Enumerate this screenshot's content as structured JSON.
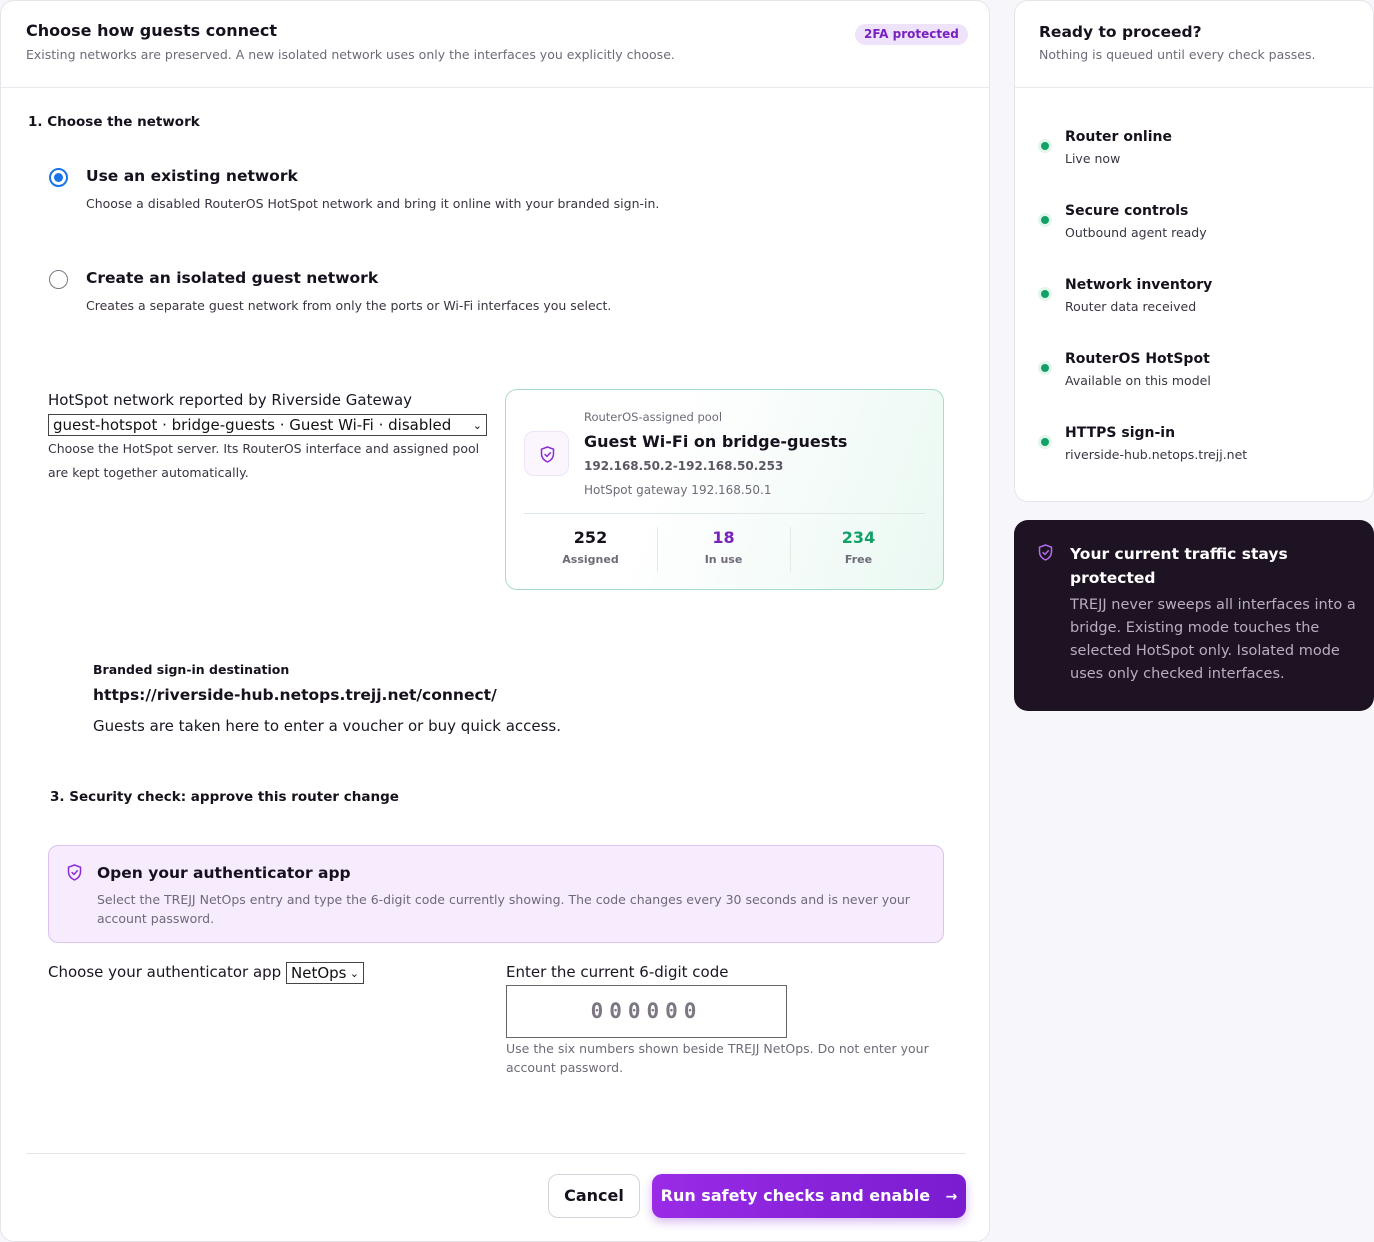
{
  "header": {
    "title": "Choose how guests connect",
    "subtitle": "Existing networks are preserved. A new isolated network uses only the interfaces you explicitly choose.",
    "badge": "2FA protected"
  },
  "step1": {
    "title": "1. Choose the network",
    "options": [
      {
        "title": "Use an existing network",
        "desc": "Choose a disabled RouterOS HotSpot network and bring it online with your branded sign-in.",
        "selected": true
      },
      {
        "title": "Create an isolated guest network",
        "desc": "Creates a separate guest network from only the ports or Wi-Fi interfaces you select.",
        "selected": false
      }
    ]
  },
  "hotspot": {
    "label": "HotSpot network reported by Riverside Gateway",
    "selected": "guest-hotspot · bridge-guests · Guest Wi-Fi · disabled",
    "help_line1": "Choose the HotSpot server. Its RouterOS interface and assigned pool",
    "help_line2": "are kept together automatically."
  },
  "pool": {
    "kicker": "RouterOS-assigned pool",
    "name": "Guest Wi-Fi on bridge-guests",
    "range": "192.168.50.2-192.168.50.253",
    "gateway": "HotSpot gateway 192.168.50.1",
    "stats": [
      {
        "value": "252",
        "label": "Assigned",
        "color": "#16111d"
      },
      {
        "value": "18",
        "label": "In use",
        "color": "#7722bf"
      },
      {
        "value": "234",
        "label": "Free",
        "color": "#13a068"
      }
    ]
  },
  "destination": {
    "label": "Branded sign-in destination",
    "url": "https://riverside-hub.netops.trejj.net/connect/",
    "desc": "Guests are taken here to enter a voucher or buy quick access."
  },
  "step3": {
    "title": "3. Security check: approve this router change",
    "auth_title": "Open your authenticator app",
    "auth_desc": "Select the TREJJ NetOps entry and type the 6-digit code currently showing. The code changes every 30 seconds and is never your account password.",
    "app_label": "Choose your authenticator app",
    "app_selected": "NetOps",
    "code_label": "Enter the current 6-digit code",
    "code_placeholder": "000000",
    "code_help": "Use the six numbers shown beside TREJJ NetOps. Do not enter your account password."
  },
  "footer": {
    "cancel": "Cancel",
    "run": "Run safety checks and enable",
    "run_arrow": "→"
  },
  "side": {
    "title": "Ready to proceed?",
    "subtitle": "Nothing is queued until every check passes.",
    "checks": [
      {
        "title": "Router online",
        "sub": "Live now"
      },
      {
        "title": "Secure controls",
        "sub": "Outbound agent ready"
      },
      {
        "title": "Network inventory",
        "sub": "Router data received"
      },
      {
        "title": "RouterOS HotSpot",
        "sub": "Available on this model"
      },
      {
        "title": "HTTPS sign-in",
        "sub": "riverside-hub.netops.trejj.net"
      }
    ]
  },
  "notice": {
    "title": "Your current traffic stays protected",
    "body": "TREJJ never sweeps all interfaces into a bridge. Existing mode touches the selected HotSpot only. Isolated mode uses only checked interfaces."
  },
  "icons": {
    "shield": "shield-icon",
    "chevron": "chevron-down-icon",
    "arrow": "arrow-right-icon",
    "status_dot": "status-dot-icon"
  },
  "colors": {
    "accent": "#7722bf",
    "success": "#13a068",
    "dark": "#1d1322"
  }
}
